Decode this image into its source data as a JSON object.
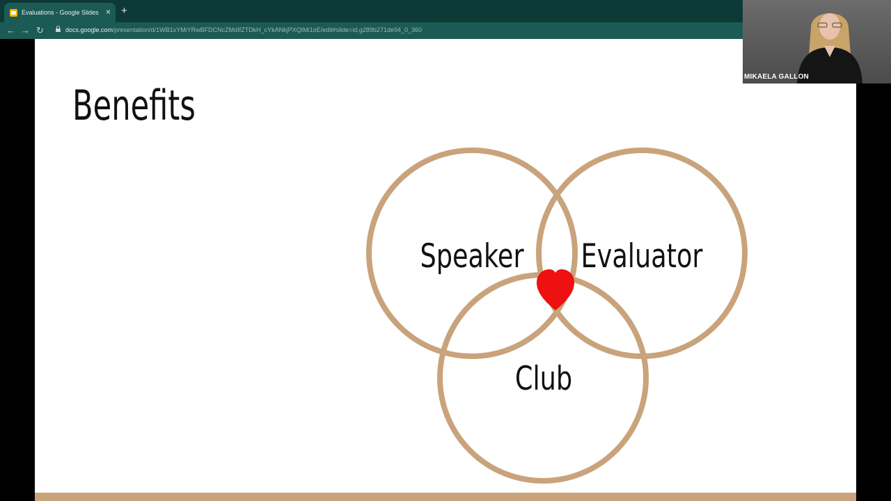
{
  "browser": {
    "tab_title": "Evaluations - Google Slides",
    "tab_close": "×",
    "new_tab": "+",
    "nav": {
      "back": "←",
      "forward": "→",
      "reload": "↻"
    },
    "url_domain": "docs.google.com",
    "url_path": "/presentation/d/1WB1xYMiYRwBFDCNcZMdIfZTDkH_cYkANkjPXQtMi1oE/edit#slide=id.g289b271de94_0_360"
  },
  "slide": {
    "title": "Benefits",
    "venn": {
      "labels": [
        "Speaker",
        "Evaluator",
        "Club"
      ],
      "circle_color": "#c9a37b",
      "heart_color": "#ee1111"
    },
    "accent_bar_color": "#c9a37b"
  },
  "webcam": {
    "name": "MIKAELA GALLON"
  }
}
